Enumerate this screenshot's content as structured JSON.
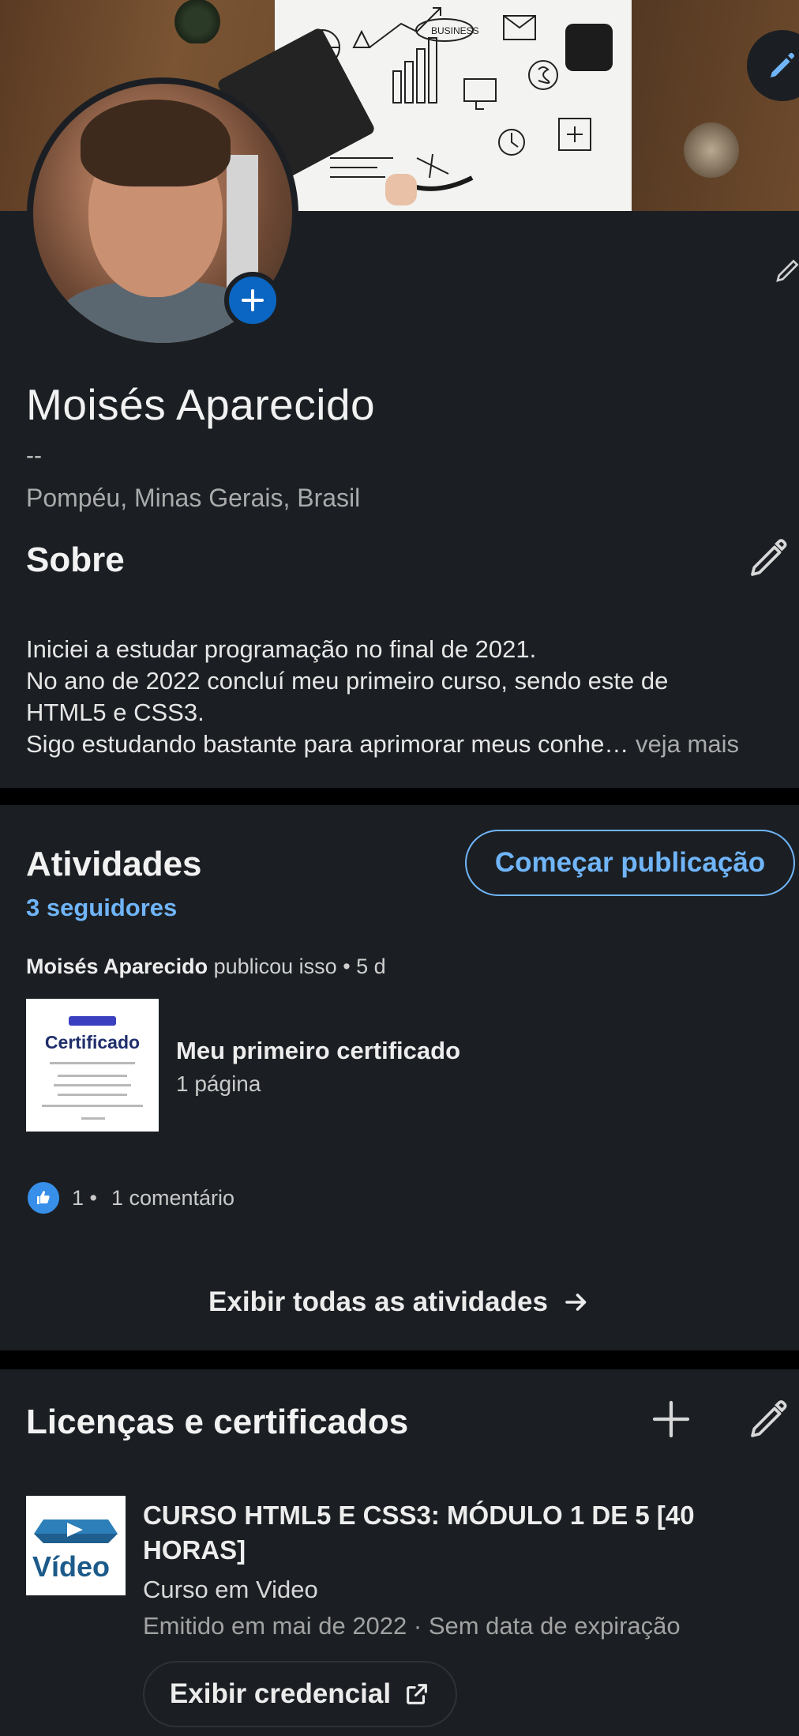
{
  "profile": {
    "name": "Moisés Aparecido",
    "headline": "--",
    "location": "Pompéu, Minas Gerais, Brasil"
  },
  "cover": {
    "paper_text": "BUSINESS"
  },
  "about": {
    "title": "Sobre",
    "lines": [
      "Iniciei a estudar programação no final de 2021.",
      "No ano de 2022 concluí meu primeiro curso, sendo este de",
      "HTML5 e CSS3.",
      "Sigo estudando bastante para aprimorar meus conhe…"
    ],
    "see_more": "veja mais"
  },
  "activities": {
    "title": "Atividades",
    "followers": "3 seguidores",
    "start_post_label": "Começar publicação",
    "post": {
      "author": "Moisés Aparecido",
      "meta": "publicou isso • 5 d",
      "thumb_title": "Certificado",
      "title": "Meu primeiro certificado",
      "pages": "1 página",
      "reaction_count": "1 •",
      "comments": "1 comentário"
    },
    "show_all_label": "Exibir todas as atividades"
  },
  "licenses": {
    "title": "Licenças e certificados",
    "item": {
      "name": "CURSO HTML5 E CSS3: MÓDULO 1 DE 5 [40 HORAS]",
      "issuer": "Curso em Video",
      "logo_text": "Vídeo",
      "date": "Emitido em mai de 2022 · Sem data de expiração",
      "credential_label": "Exibir credencial"
    }
  },
  "colors": {
    "accent": "#70b5f9",
    "primary_blue": "#0a66c2",
    "card_bg": "#1b1f23"
  },
  "icons": [
    "pencil-icon",
    "plus-icon",
    "like-icon",
    "arrow-right-icon",
    "external-link-icon"
  ]
}
